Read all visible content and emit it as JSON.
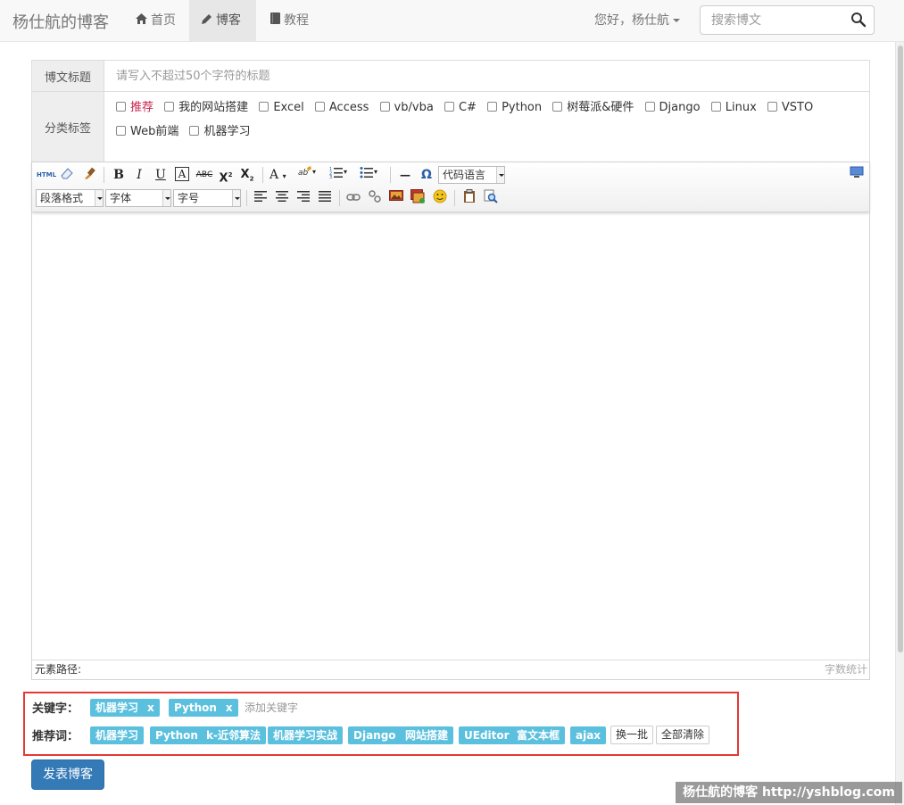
{
  "navbar": {
    "brand": "杨仕航的博客",
    "items": [
      {
        "label": "首页",
        "icon": "home-icon"
      },
      {
        "label": "博客",
        "icon": "pencil-icon"
      },
      {
        "label": "教程",
        "icon": "book-icon"
      }
    ],
    "greeting": "您好，杨仕航",
    "search_placeholder": "搜索博文"
  },
  "form": {
    "title_label": "博文标题",
    "title_placeholder": "请写入不超过50个字符的标题",
    "category_label": "分类标签",
    "categories": [
      "推荐",
      "我的网站搭建",
      "Excel",
      "Access",
      "vb/vba",
      "C#",
      "Python",
      "树莓派&硬件",
      "Django",
      "Linux",
      "VSTO",
      "Web前端",
      "机器学习"
    ]
  },
  "editor": {
    "toolbar": {
      "html_label": "HTML",
      "code_lang_label": "代码语言",
      "paragraph_label": "段落格式",
      "font_label": "字体",
      "size_label": "字号"
    },
    "element_path_label": "元素路径:",
    "word_count_label": "字数统计"
  },
  "keywords": {
    "label": "关键字：",
    "selected": [
      "机器学习",
      "Python"
    ],
    "remove_glyph": "x",
    "add_placeholder": "添加关键字",
    "recommend_label": "推荐词：",
    "recommended": [
      "机器学习",
      "Python",
      "k-近邻算法",
      "机器学习实战",
      "Django",
      "网站搭建",
      "UEditor",
      "富文本框",
      "ajax"
    ],
    "refresh_label": "换一批",
    "clear_label": "全部清除"
  },
  "submit_label": "发表博客",
  "watermark": "杨仕航的博客 http://yshblog.com"
}
